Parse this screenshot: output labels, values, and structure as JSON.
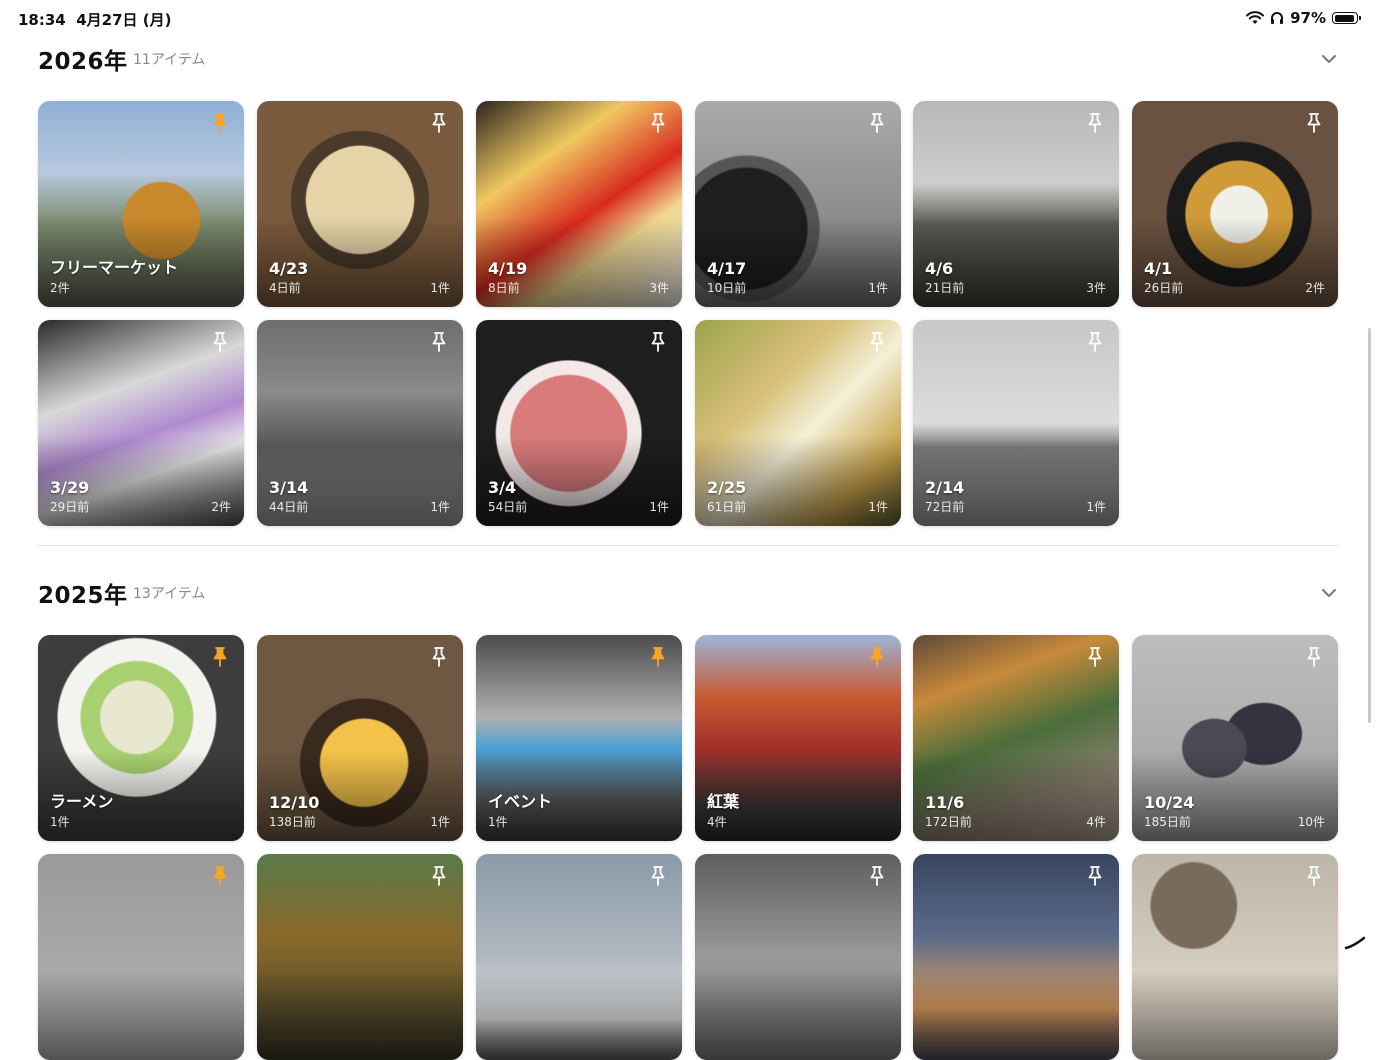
{
  "status": {
    "time": "18:34",
    "date": "4月27日 (月)",
    "battery": "97%"
  },
  "colors": {
    "pin_active": "#f5a623",
    "pin_inactive": "#ffffff"
  },
  "sections": [
    {
      "year": "2026年",
      "count": "11アイテム",
      "items": [
        {
          "title": "フリーマーケット",
          "sub": "2件",
          "count": "",
          "pinned": true,
          "photo": "p1"
        },
        {
          "title": "4/23",
          "sub": "4日前",
          "count": "1件",
          "pinned": false,
          "photo": "p2"
        },
        {
          "title": "4/19",
          "sub": "8日前",
          "count": "3件",
          "pinned": false,
          "photo": "p3"
        },
        {
          "title": "4/17",
          "sub": "10日前",
          "count": "1件",
          "pinned": false,
          "photo": "p4"
        },
        {
          "title": "4/6",
          "sub": "21日前",
          "count": "3件",
          "pinned": false,
          "photo": "p5"
        },
        {
          "title": "4/1",
          "sub": "26日前",
          "count": "2件",
          "pinned": false,
          "photo": "p6"
        },
        {
          "title": "3/29",
          "sub": "29日前",
          "count": "2件",
          "pinned": false,
          "photo": "p7"
        },
        {
          "title": "3/14",
          "sub": "44日前",
          "count": "1件",
          "pinned": false,
          "photo": "p8"
        },
        {
          "title": "3/4",
          "sub": "54日前",
          "count": "1件",
          "pinned": false,
          "photo": "p9"
        },
        {
          "title": "2/25",
          "sub": "61日前",
          "count": "1件",
          "pinned": false,
          "photo": "p10"
        },
        {
          "title": "2/14",
          "sub": "72日前",
          "count": "1件",
          "pinned": false,
          "photo": "p11"
        }
      ]
    },
    {
      "year": "2025年",
      "count": "13アイテム",
      "items": [
        {
          "title": "ラーメン",
          "sub": "1件",
          "count": "",
          "pinned": true,
          "photo": "p12"
        },
        {
          "title": "12/10",
          "sub": "138日前",
          "count": "1件",
          "pinned": false,
          "photo": "p13"
        },
        {
          "title": "イベント",
          "sub": "1件",
          "count": "",
          "pinned": true,
          "photo": "p14"
        },
        {
          "title": "紅葉",
          "sub": "4件",
          "count": "",
          "pinned": true,
          "photo": "p15"
        },
        {
          "title": "11/6",
          "sub": "172日前",
          "count": "4件",
          "pinned": false,
          "photo": "p16"
        },
        {
          "title": "10/24",
          "sub": "185日前",
          "count": "10件",
          "pinned": false,
          "photo": "p17"
        },
        {
          "title": "",
          "sub": "",
          "count": "",
          "pinned": true,
          "photo": "p18"
        },
        {
          "title": "",
          "sub": "",
          "count": "",
          "pinned": false,
          "photo": "p19"
        },
        {
          "title": "",
          "sub": "",
          "count": "",
          "pinned": false,
          "photo": "p20"
        },
        {
          "title": "",
          "sub": "",
          "count": "",
          "pinned": false,
          "photo": "p21"
        },
        {
          "title": "",
          "sub": "",
          "count": "",
          "pinned": false,
          "photo": "p22"
        },
        {
          "title": "",
          "sub": "",
          "count": "",
          "pinned": false,
          "photo": "p23"
        }
      ]
    }
  ]
}
